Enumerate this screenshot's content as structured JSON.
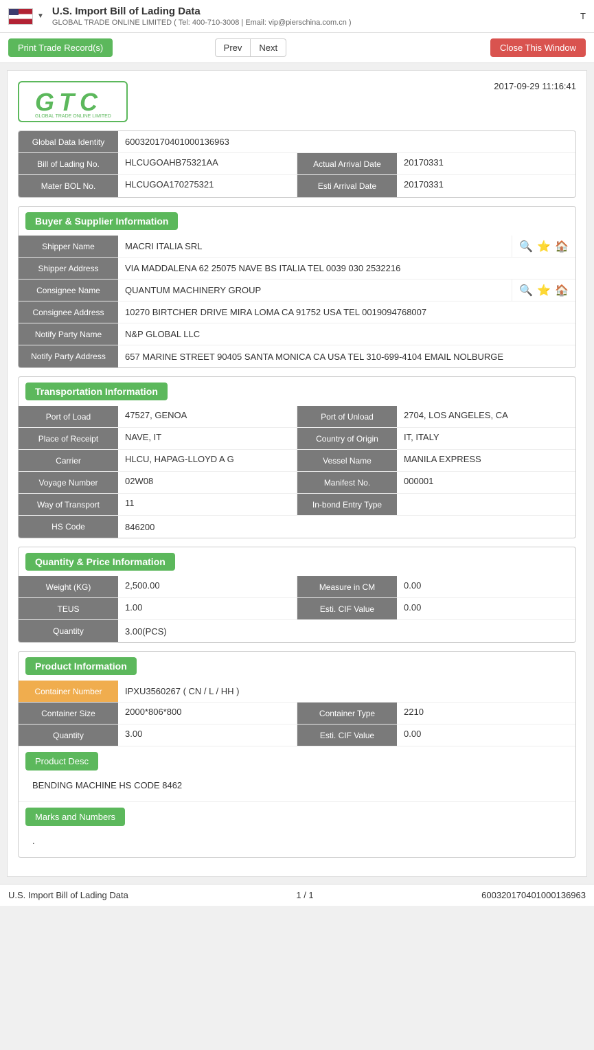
{
  "header": {
    "title": "U.S. Import Bill of Lading Data",
    "subtitle": "GLOBAL TRADE ONLINE LIMITED ( Tel: 400-710-3008 | Email: vip@pierschina.com.cn )",
    "right_text": "T"
  },
  "toolbar": {
    "print_label": "Print Trade Record(s)",
    "prev_label": "Prev",
    "next_label": "Next",
    "close_label": "Close This Window"
  },
  "logo": {
    "text": "GTC",
    "subtitle": "GLOBAL TRADE ONLINE LIMITED",
    "timestamp": "2017-09-29 11:16:41"
  },
  "identity": {
    "global_data_label": "Global Data Identity",
    "global_data_value": "600320170401000136963",
    "bol_label": "Bill of Lading No.",
    "bol_value": "HLCUGOAHB75321AA",
    "arrival_actual_label": "Actual Arrival Date",
    "arrival_actual_value": "20170331",
    "master_bol_label": "Mater BOL No.",
    "master_bol_value": "HLCUGOA170275321",
    "arrival_esti_label": "Esti Arrival Date",
    "arrival_esti_value": "20170331"
  },
  "buyer_supplier": {
    "section_title": "Buyer & Supplier Information",
    "shipper_name_label": "Shipper Name",
    "shipper_name_value": "MACRI ITALIA SRL",
    "shipper_address_label": "Shipper Address",
    "shipper_address_value": "VIA MADDALENA 62 25075 NAVE BS ITALIA TEL 0039 030 2532216",
    "consignee_name_label": "Consignee Name",
    "consignee_name_value": "QUANTUM MACHINERY GROUP",
    "consignee_address_label": "Consignee Address",
    "consignee_address_value": "10270 BIRTCHER DRIVE MIRA LOMA CA 91752 USA TEL 0019094768007",
    "notify_party_name_label": "Notify Party Name",
    "notify_party_name_value": "N&P GLOBAL LLC",
    "notify_party_address_label": "Notify Party Address",
    "notify_party_address_value": "657 MARINE STREET 90405 SANTA MONICA CA USA TEL 310-699-4104 EMAIL NOLBURGE"
  },
  "transportation": {
    "section_title": "Transportation Information",
    "port_of_load_label": "Port of Load",
    "port_of_load_value": "47527, GENOA",
    "port_of_unload_label": "Port of Unload",
    "port_of_unload_value": "2704, LOS ANGELES, CA",
    "place_of_receipt_label": "Place of Receipt",
    "place_of_receipt_value": "NAVE, IT",
    "country_of_origin_label": "Country of Origin",
    "country_of_origin_value": "IT, ITALY",
    "carrier_label": "Carrier",
    "carrier_value": "HLCU, HAPAG-LLOYD A G",
    "vessel_name_label": "Vessel Name",
    "vessel_name_value": "MANILA EXPRESS",
    "voyage_number_label": "Voyage Number",
    "voyage_number_value": "02W08",
    "manifest_no_label": "Manifest No.",
    "manifest_no_value": "000001",
    "way_of_transport_label": "Way of Transport",
    "way_of_transport_value": "11",
    "inbond_entry_label": "In-bond Entry Type",
    "inbond_entry_value": "",
    "hs_code_label": "HS Code",
    "hs_code_value": "846200"
  },
  "quantity_price": {
    "section_title": "Quantity & Price Information",
    "weight_label": "Weight (KG)",
    "weight_value": "2,500.00",
    "measure_label": "Measure in CM",
    "measure_value": "0.00",
    "teus_label": "TEUS",
    "teus_value": "1.00",
    "esti_cif_label": "Esti. CIF Value",
    "esti_cif_value": "0.00",
    "quantity_label": "Quantity",
    "quantity_value": "3.00(PCS)"
  },
  "product": {
    "section_title": "Product Information",
    "container_number_label": "Container Number",
    "container_number_value": "IPXU3560267 ( CN / L / HH )",
    "container_size_label": "Container Size",
    "container_size_value": "2000*806*800",
    "container_type_label": "Container Type",
    "container_type_value": "2210",
    "quantity_label": "Quantity",
    "quantity_value": "3.00",
    "esti_cif_label": "Esti. CIF Value",
    "esti_cif_value": "0.00",
    "product_desc_label": "Product Desc",
    "product_desc_value": "BENDING MACHINE HS CODE 8462",
    "marks_numbers_label": "Marks and Numbers",
    "marks_numbers_value": "."
  },
  "footer": {
    "left": "U.S. Import Bill of Lading Data",
    "center": "1 / 1",
    "right": "600320170401000136963"
  }
}
